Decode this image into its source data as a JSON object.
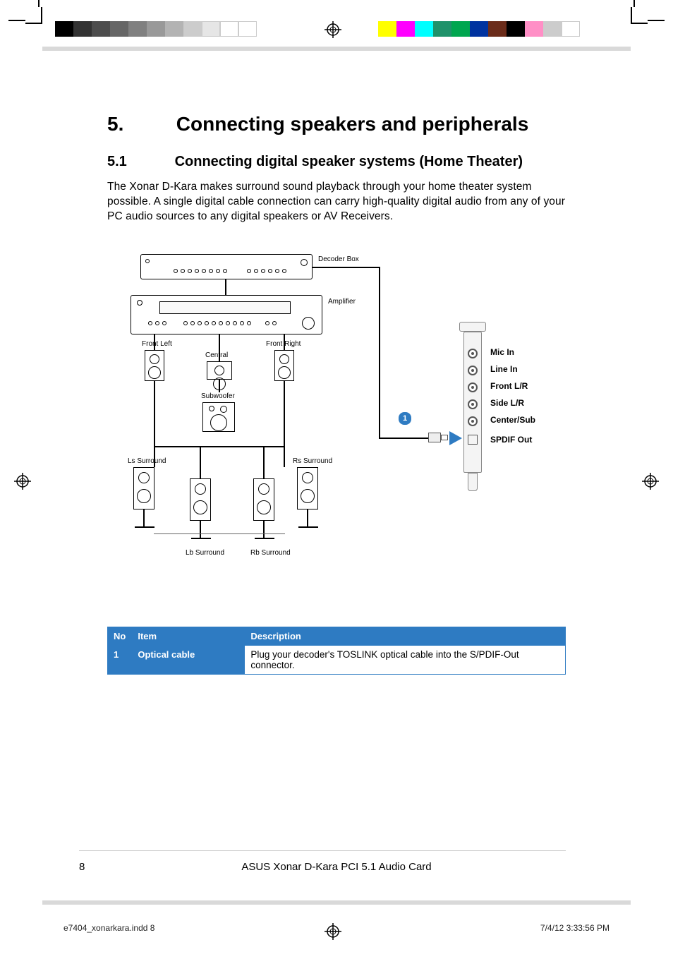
{
  "section": {
    "num": "5.",
    "title": "Connecting speakers and peripherals"
  },
  "subsection": {
    "num": "5.1",
    "title": "Connecting digital speaker systems (Home Theater)"
  },
  "paragraph": "The Xonar D-Kara makes surround sound playback through your home theater system possible. A single digital cable connection can carry high-quality digital audio from any of your PC audio sources to any digital speakers or AV Receivers.",
  "diagram": {
    "decoder": "Decoder Box",
    "amplifier": "Amplifier",
    "front_left": "Front Left",
    "front_right": "Front Right",
    "central": "Central",
    "subwoofer": "Subwoofer",
    "ls": "Ls Surround",
    "rs": "Rs Surround",
    "lb": "Lb Surround",
    "rb": "Rb Surround",
    "ports": {
      "mic": "Mic In",
      "line": "Line In",
      "front": "Front L/R",
      "side": "Side L/R",
      "center": "Center/Sub",
      "spdif": "SPDIF Out"
    },
    "callout1": "1"
  },
  "table": {
    "headers": {
      "no": "No",
      "item": "Item",
      "desc": "Description"
    },
    "rows": [
      {
        "no": "1",
        "item": "Optical cable",
        "desc": "Plug your decoder's TOSLINK optical cable into the S/PDIF-Out connector."
      }
    ]
  },
  "footer": {
    "page": "8",
    "title": "ASUS Xonar D-Kara PCI 5.1 Audio Card",
    "slug": "e7404_xonarkara.indd   8",
    "timestamp": "7/4/12   3:33:56 PM"
  },
  "swatches_left": [
    "#000000",
    "#333333",
    "#4d4d4d",
    "#666666",
    "#808080",
    "#999999",
    "#b3b3b3",
    "#cccccc",
    "#e6e6e6",
    "#ffffff",
    "#ffffff"
  ],
  "swatches_right": [
    "#ffff00",
    "#ff00ff",
    "#00ffff",
    "#009955",
    "#00aa00",
    "#0000ff",
    "#6b2c1a",
    "#000000",
    "#ff99cc",
    "#cccccc",
    "#ffffff"
  ]
}
